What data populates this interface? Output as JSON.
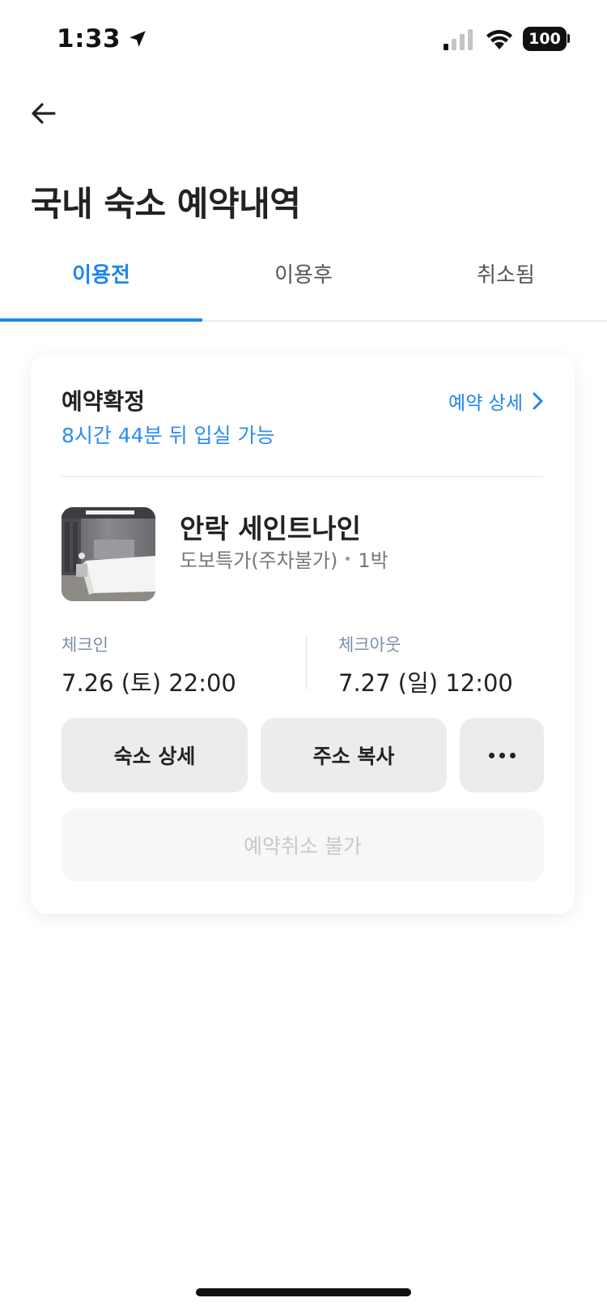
{
  "status_bar": {
    "time": "1:33",
    "battery": "100"
  },
  "header": {
    "title": "국내 숙소 예약내역"
  },
  "tabs": [
    {
      "label": "이용전",
      "active": true
    },
    {
      "label": "이용후",
      "active": false
    },
    {
      "label": "취소됨",
      "active": false
    }
  ],
  "reservation": {
    "status": "예약확정",
    "eta": "8시간 44분 뒤 입실 가능",
    "detail_link": "예약 상세",
    "hotel_name": "안락 세인트나인",
    "room_type": "도보특가(주차불가)",
    "nights": "1박",
    "checkin_label": "체크인",
    "checkin_value": "7.26 (토) 22:00",
    "checkout_label": "체크아웃",
    "checkout_value": "7.27 (일) 12:00",
    "hotel_detail_button": "숙소 상세",
    "copy_address_button": "주소 복사",
    "cancel_button": "예약취소 불가"
  },
  "colors": {
    "accent": "#1c86ee",
    "label": "#7b8ea8"
  },
  "icons": {
    "back": "arrow-left-icon",
    "location": "location-arrow-icon",
    "chevron": "chevron-right-icon",
    "more": "more-horizontal-icon"
  }
}
